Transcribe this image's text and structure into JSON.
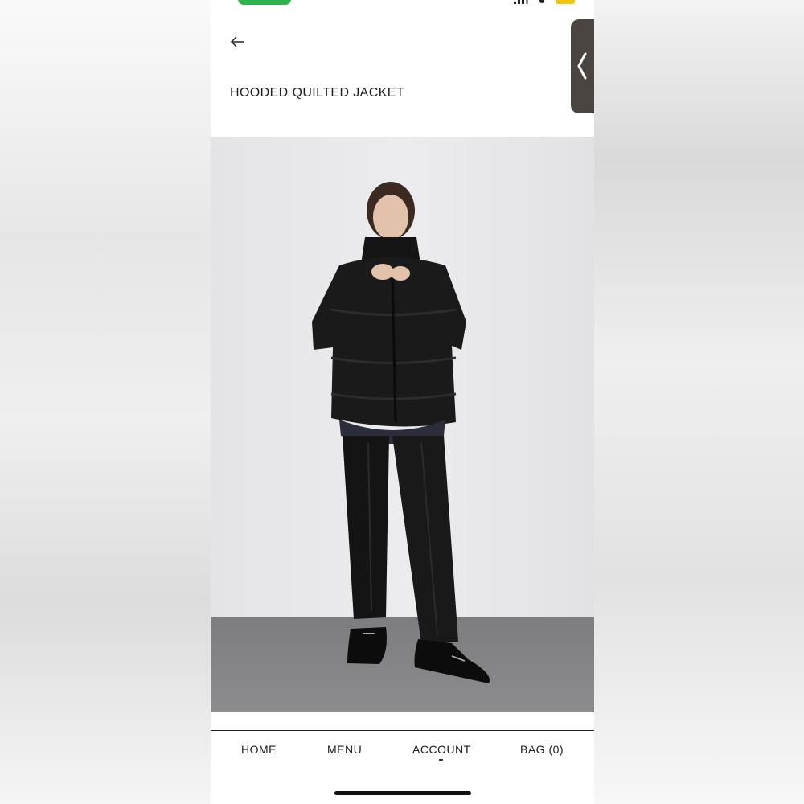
{
  "header": {
    "title": "HOODED QUILTED JACKET"
  },
  "icons": {
    "back": "arrow-left-icon",
    "side_handle": "chevron-left-icon"
  },
  "product": {
    "image_alt": "product-photo"
  },
  "bottom_nav": {
    "items": [
      {
        "label": "HOME"
      },
      {
        "label": "MENU"
      },
      {
        "label": "ACCOUNT"
      },
      {
        "label": "BAG (0)"
      }
    ],
    "active": "ACCOUNT"
  },
  "colors": {
    "status_green": "#2fb24a",
    "battery": "#f1c40f",
    "handle": "#4a4541"
  }
}
